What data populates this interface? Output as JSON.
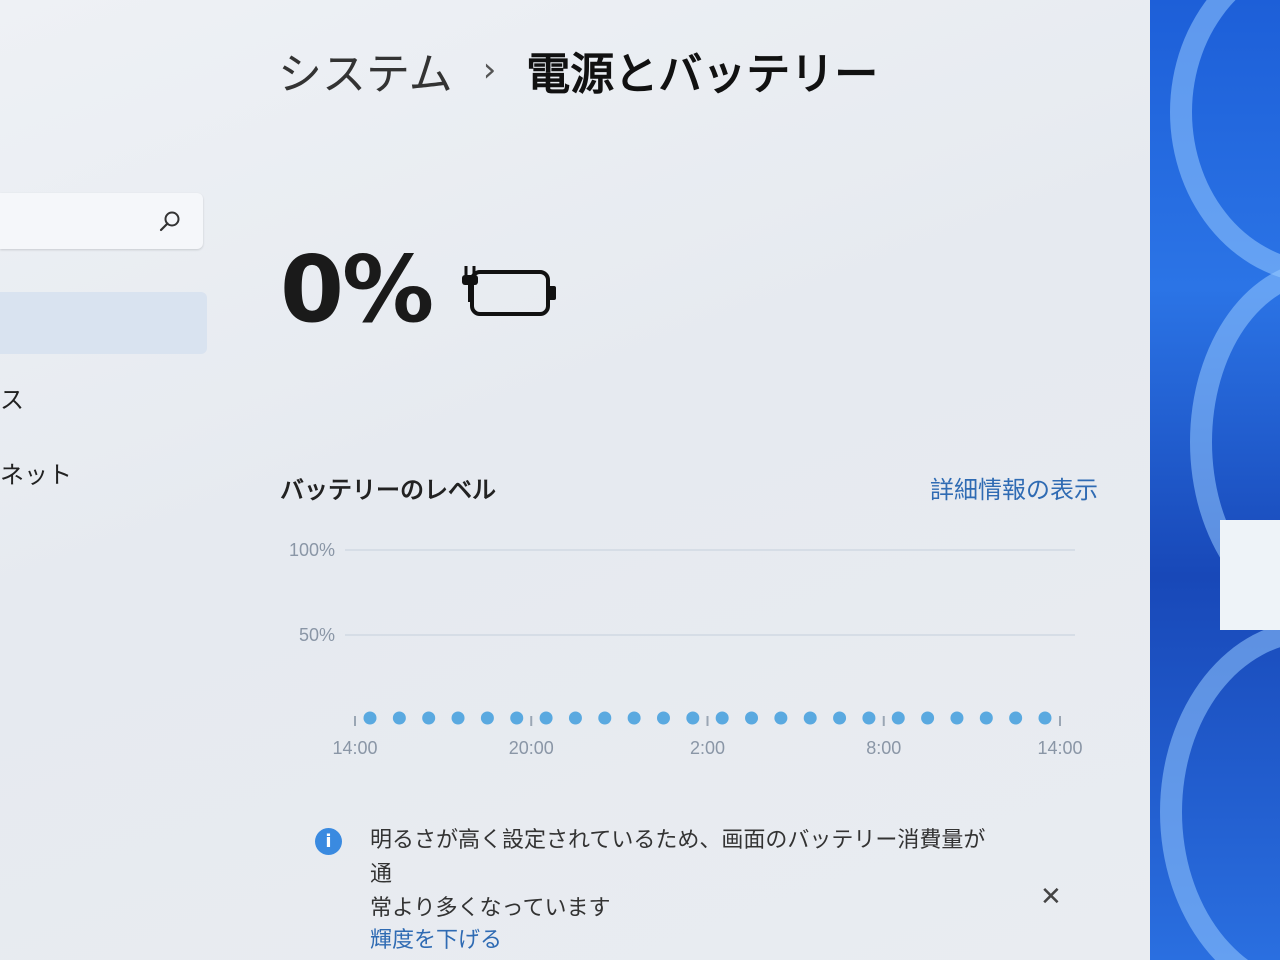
{
  "breadcrumb": {
    "parent": "システム",
    "separator": "›",
    "current": "電源とバッテリー"
  },
  "sidebar": {
    "items": [
      {
        "label": "ス"
      },
      {
        "label": "ネット"
      }
    ]
  },
  "battery": {
    "percent_label": "0%",
    "level": 0.0
  },
  "battery_level": {
    "title": "バッテリーのレベル",
    "details_link": "詳細情報の表示",
    "chart_data": {
      "type": "scatter",
      "title": "",
      "xlabel": "",
      "ylabel": "",
      "y_ticks": [
        "100%",
        "50%"
      ],
      "x_ticks": [
        "14:00",
        "20:00",
        "2:00",
        "8:00",
        "14:00"
      ],
      "ylim": [
        0,
        100
      ],
      "grid": true,
      "color": "#5aa9e0",
      "values": [
        0,
        0,
        0,
        0,
        0,
        0,
        0,
        0,
        0,
        0,
        0,
        0,
        0,
        0,
        0,
        0,
        0,
        0,
        0,
        0,
        0,
        0,
        0,
        0
      ]
    }
  },
  "notice": {
    "icon": "info-icon",
    "text_line1": "明るさが高く設定されているため、画面のバッテリー消費量が通",
    "text_line2": "常より多くなっています",
    "action_link": "輝度を下げる",
    "close_symbol": "✕"
  }
}
